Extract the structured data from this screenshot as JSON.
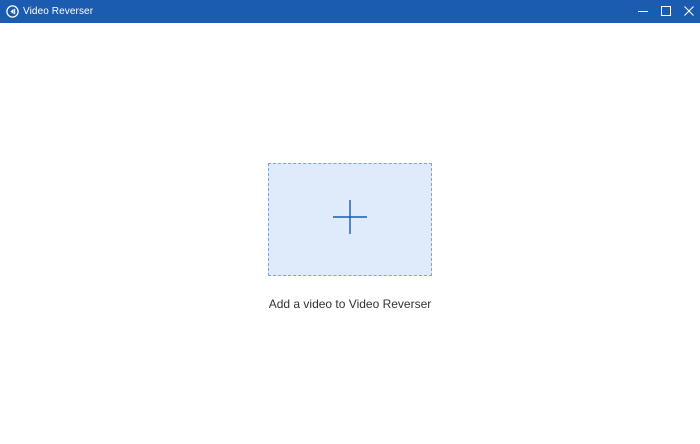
{
  "window": {
    "title": "Video Reverser",
    "titlebar_color": "#1b5bb0"
  },
  "controls": {
    "minimize": "minimize-icon",
    "maximize": "maximize-icon",
    "close": "close-icon"
  },
  "main": {
    "dropzone_icon": "plus-icon",
    "caption": "Add a video to Video Reverser",
    "accent_color": "#1b5bb0",
    "dropzone_fill": "#dfeafb"
  }
}
